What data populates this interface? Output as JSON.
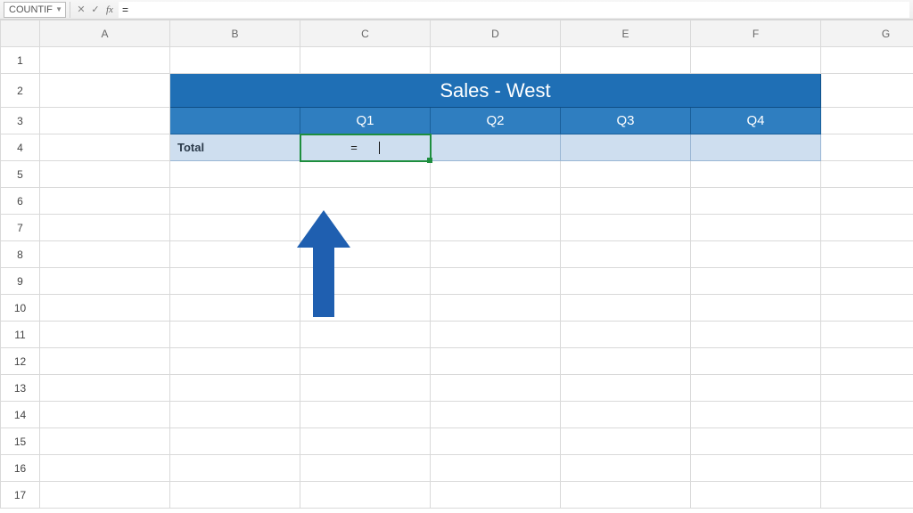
{
  "formula_bar": {
    "name_box_value": "COUNTIF",
    "cancel": "✕",
    "confirm": "✓",
    "fx_label": "fx",
    "formula_value": "="
  },
  "columns": [
    "A",
    "B",
    "C",
    "D",
    "E",
    "F",
    "G"
  ],
  "rows": [
    "1",
    "2",
    "3",
    "4",
    "5",
    "6",
    "7",
    "8",
    "9",
    "10",
    "11",
    "12",
    "13",
    "14",
    "15",
    "16",
    "17"
  ],
  "active_column": "C",
  "active_row": "4",
  "sheet": {
    "title": "Sales - West",
    "headers": {
      "q1": "Q1",
      "q2": "Q2",
      "q3": "Q3",
      "q4": "Q4"
    },
    "row_label": "Total",
    "active_entry": "="
  },
  "colors": {
    "header_dark": "#1f6fb5",
    "header_mid": "#2f7ec0",
    "row_light": "#cedeef",
    "arrow": "#1f5fb0",
    "selection_green": "#1e8e3e"
  }
}
